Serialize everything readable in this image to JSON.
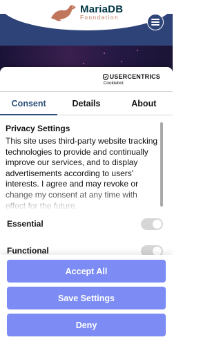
{
  "site": {
    "logo_name": "MariaDB",
    "logo_sub": "Foundation",
    "menu_icon": "hamburger-icon",
    "brand_color": "#2e4478"
  },
  "consent": {
    "brand_name": "USERCENTRICS",
    "brand_sub": "Cookiebot",
    "tabs": [
      {
        "label": "Consent",
        "active": true
      },
      {
        "label": "Details",
        "active": false
      },
      {
        "label": "About",
        "active": false
      }
    ],
    "section_title": "Privacy Settings",
    "section_text": "This site uses third-party website tracking technologies to provide and continually improve our services, and to display advertisements according to users' interests. I agree and may revoke or change my consent at any time with effect for the future.",
    "toggles": [
      {
        "label": "Essential",
        "enabled": false
      },
      {
        "label": "Functional",
        "enabled": false
      }
    ],
    "buttons": {
      "accept_all": "Accept All",
      "save_settings": "Save Settings",
      "deny": "Deny"
    },
    "accent_color": "#2b4f7a",
    "button_color": "#7d8cf4"
  }
}
